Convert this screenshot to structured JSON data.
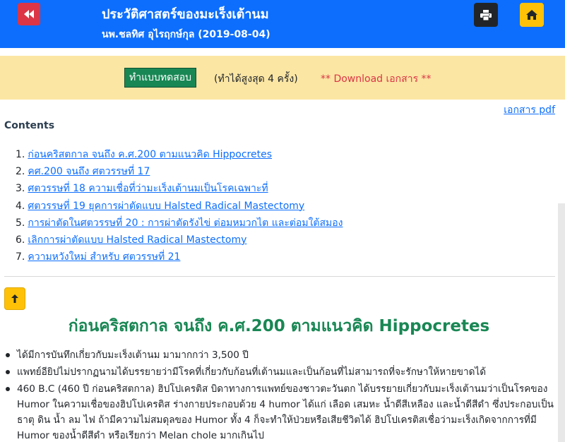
{
  "header": {
    "title": "ประวัติศาสตร์ของมะเร็งเต้านม",
    "subtitle": "นพ.ชลทิศ อุไรฤกษ์กุล (2019-08-04)"
  },
  "banner": {
    "quiz_button": "ทำแบบทดสอบ",
    "quiz_note": "(ทำได้สูงสุด 4 ครั้ง)",
    "download": "** Download เอกสาร **"
  },
  "pdf_link": "เอกสาร pdf",
  "contents_heading": "Contents",
  "toc": [
    {
      "num": "1.",
      "label": "ก่อนคริสตกาล จนถึง ค.ศ.200 ตามแนวคิด Hippocretes"
    },
    {
      "num": "2.",
      "label": "คศ.200 จนถึง ศตวรรษที่ 17"
    },
    {
      "num": "3.",
      "label": "ศตวรรษที่ 18 ความเชื่อที่ว่ามะเร็งเต้านมเป็นโรคเฉพาะที่"
    },
    {
      "num": "4.",
      "label": "ศตวรรษที่ 19 ยุคการผ่าตัดแบบ Halsted Radical Mastectomy"
    },
    {
      "num": "5.",
      "label": "การผ่าตัดในศตวรรษที่ 20 : การผ่าตัดรังไข่ ต่อมหมวกไต และต่อมใต้สมอง"
    },
    {
      "num": "6.",
      "label": "เลิกการผ่าตัดแบบ Halsted Radical Mastectomy"
    },
    {
      "num": "7.",
      "label": "ความหวังใหม่ สำหรับ ศตวรรษที่ 21"
    }
  ],
  "section": {
    "title": "ก่อนคริสตกาล จนถึง ค.ศ.200 ตามแนวคิด Hippocretes",
    "bullets": [
      "ได้มีการบันทึกเกี่ยวกับมะเร็งเต้านม มามากกว่า 3,500 ปี",
      "แพทย์อียิปไม่ปรากฏนามได้บรรยายว่ามีโรคที่เกี่ยวกับก้อนที่เต้านมและเป็นก้อนที่ไม่สามารถที่จะรักษาให้หายขาดได้",
      "460 B.C (460 ปี ก่อนคริสตกาล) ฮิปโปเครติส บิดาทางการแพทย์ของชาวตะวันตก ได้บรรยายเกี่ยวกับมะเร็งเต้านมว่าเป็นโรคของ Humor ในความเชื่อของฮิปโปเครติส ร่างกายประกอบด้วย 4 humor ได้แก่ เลือด เสมหะ น้ำดีสีเหลือง และน้ำดีสีดำ ซึ่งประกอบเป็นธาตุ ดิน น้ำ ลม ไฟ ถ้ามีความไม่สมดุลของ Humor ทั้ง 4 ก็จะทำให้ป่วยหรือเสียชีวิตได้ ฮิปโปเครติสเชื่อว่ามะเร็งเกิดจากการที่มี Humor ของน้ำดีสีดำ หรือเรียกว่า Melan chole มากเกินไป"
    ]
  },
  "colors": {
    "header_bg": "#0d6efd",
    "banner_bg": "#fbe6a4",
    "quiz_button_bg": "#198754",
    "download_text": "#dc3545",
    "section_title": "#198754",
    "link": "#0d6efd"
  },
  "icons": {
    "back": "fast-backward-icon",
    "print": "print-icon",
    "home": "home-icon",
    "up": "arrow-up-icon"
  }
}
